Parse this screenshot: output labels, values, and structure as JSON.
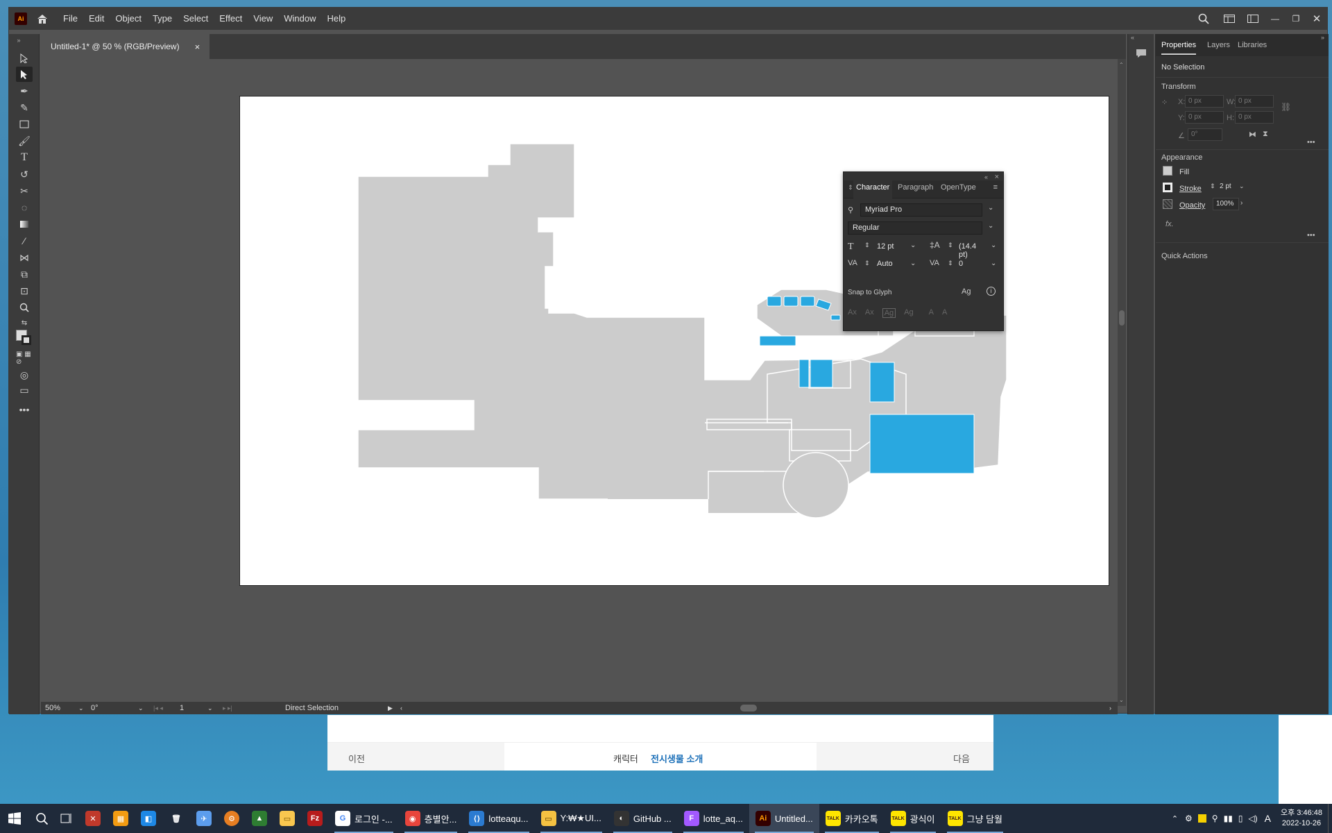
{
  "app": {
    "logo": "Ai",
    "menus": [
      "File",
      "Edit",
      "Object",
      "Type",
      "Select",
      "Effect",
      "View",
      "Window",
      "Help"
    ],
    "doc_tab_title": "Untitled-1* @ 50 % (RGB/Preview)"
  },
  "statusbar": {
    "zoom": "50%",
    "rotation": "0°",
    "artboard": "1",
    "tool": "Direct Selection"
  },
  "character_panel": {
    "tabs": [
      "Character",
      "Paragraph",
      "OpenType"
    ],
    "font_family": "Myriad Pro",
    "font_style": "Regular",
    "size": "12 pt",
    "leading": "(14.4 pt)",
    "kerning": "Auto",
    "tracking": "0",
    "snap_label": "Snap to Glyph"
  },
  "properties": {
    "tabs": [
      "Properties",
      "Layers",
      "Libraries"
    ],
    "selection": "No Selection",
    "transform_label": "Transform",
    "x_label": "X:",
    "y_label": "Y:",
    "w_label": "W:",
    "h_label": "H:",
    "x_val": "0 px",
    "y_val": "0 px",
    "w_val": "0 px",
    "h_val": "0 px",
    "angle_val": "0°",
    "appearance_label": "Appearance",
    "fill_label": "Fill",
    "stroke_label": "Stroke",
    "stroke_value": "2 pt",
    "opacity_label": "Opacity",
    "opacity_value": "100%",
    "fx": "fx.",
    "quick_actions": "Quick Actions"
  },
  "web_nav": {
    "prev": "이전",
    "crumb1": "캐릭터",
    "crumb2": "전시생물 소개",
    "next": "다음"
  },
  "colors": {
    "accent": "#29a8e0",
    "floor": "#cccccc",
    "panel": "#323232",
    "chrome": "#3b3b3b"
  },
  "taskbar": {
    "items": [
      {
        "label": "로그인 -...",
        "color": "#fff",
        "glyph": "G",
        "text": "#4285f4"
      },
      {
        "label": "층별안...",
        "color": "#e8453c",
        "glyph": "◉",
        "text": "#fff"
      },
      {
        "label": "lotteaqu...",
        "color": "#2b7bd1",
        "glyph": "⟨⟩",
        "text": "#fff"
      },
      {
        "label": "Y:₩★UI...",
        "color": "#f5c242",
        "glyph": "▭",
        "text": "#5a3d00"
      },
      {
        "label": "GitHub ...",
        "color": "#333",
        "glyph": "◐",
        "text": "#fff"
      },
      {
        "label": "lotte_aq...",
        "color": "#a259ff",
        "glyph": "F",
        "text": "#fff"
      },
      {
        "label": "Untitled...",
        "color": "#330000",
        "glyph": "Ai",
        "text": "#ff9a00"
      },
      {
        "label": "카카오톡",
        "color": "#fee500",
        "glyph": "TALK",
        "text": "#3a1d1d"
      },
      {
        "label": "광식이",
        "color": "#fee500",
        "glyph": "TALK",
        "text": "#3a1d1d"
      },
      {
        "label": "그냥 담월",
        "color": "#fee500",
        "glyph": "TALK",
        "text": "#3a1d1d"
      }
    ],
    "time": "오후 3:46:48",
    "date": "2022-10-26",
    "ime": "A"
  }
}
